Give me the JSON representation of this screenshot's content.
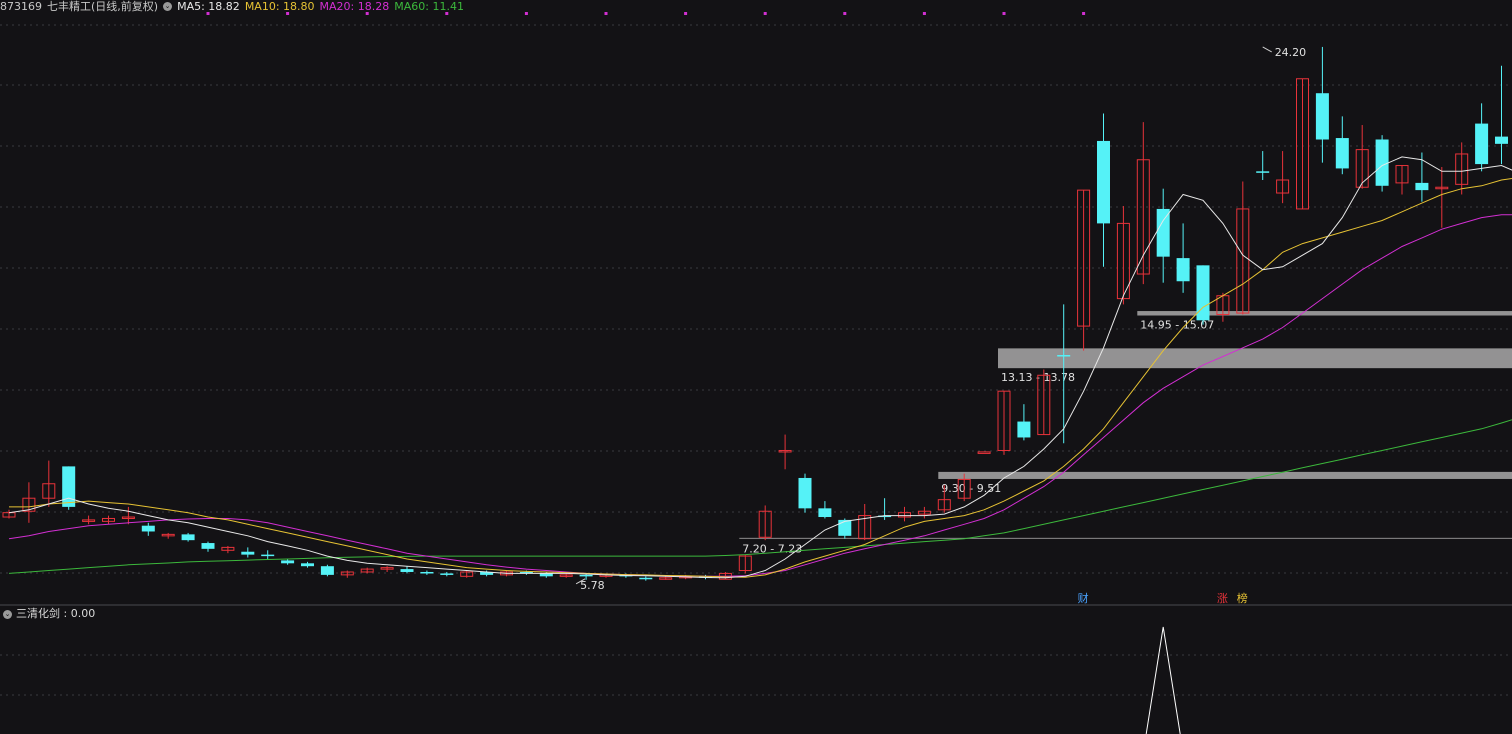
{
  "header": {
    "code": "873169",
    "name": "七丰精工",
    "period": "(日线,前复权)",
    "ma": [
      {
        "label": "MA5: 18.82",
        "color": "#e8e8e8"
      },
      {
        "label": "MA10: 18.80",
        "color": "#e6c234"
      },
      {
        "label": "MA20: 18.28",
        "color": "#d22fd2"
      },
      {
        "label": "MA60: 11.41",
        "color": "#3cb83c"
      }
    ]
  },
  "indicator": {
    "label": "三清化剑 : 0.00"
  },
  "colors": {
    "up": "#e8333a",
    "down": "#55f2f7",
    "ma5": "#e8e8e8",
    "ma10": "#e6c234",
    "ma20": "#d22fd2",
    "ma60": "#3cb83c",
    "zone": "#9a9a9a",
    "grid": "#3a3a3e",
    "event_fin": "#4aa3ff",
    "event_limit": "#e8333a",
    "event_list": "#e6c234"
  },
  "chart_data": {
    "type": "candlestick",
    "title": "",
    "price_axis": {
      "ymax": 25.2,
      "ymin": 5.6
    },
    "candles": [
      [
        7.95,
        8.1,
        8.2,
        7.9
      ],
      [
        8.15,
        8.6,
        9.15,
        7.75
      ],
      [
        8.6,
        9.1,
        9.9,
        8.3
      ],
      [
        9.7,
        8.3,
        9.7,
        8.2
      ],
      [
        7.85,
        7.85,
        8.0,
        7.7
      ],
      [
        7.8,
        7.9,
        8.0,
        7.7
      ],
      [
        7.95,
        7.95,
        8.3,
        7.7
      ],
      [
        7.65,
        7.45,
        7.75,
        7.3
      ],
      [
        7.35,
        7.35,
        7.4,
        7.2
      ],
      [
        7.35,
        7.15,
        7.4,
        7.1
      ],
      [
        7.05,
        6.85,
        7.1,
        6.75
      ],
      [
        6.8,
        6.9,
        6.95,
        6.7
      ],
      [
        6.75,
        6.65,
        6.9,
        6.55
      ],
      [
        6.65,
        6.6,
        6.8,
        6.5
      ],
      [
        6.45,
        6.35,
        6.5,
        6.3
      ],
      [
        6.35,
        6.25,
        6.4,
        6.2
      ],
      [
        6.25,
        5.95,
        6.3,
        5.9
      ],
      [
        5.95,
        6.05,
        6.1,
        5.85
      ],
      [
        6.05,
        6.15,
        6.2,
        6.0
      ],
      [
        6.15,
        6.2,
        6.25,
        6.05
      ],
      [
        6.15,
        6.05,
        6.25,
        6.0
      ],
      [
        6.05,
        6.0,
        6.1,
        5.95
      ],
      [
        6.0,
        5.95,
        6.05,
        5.9
      ],
      [
        5.9,
        6.05,
        6.1,
        5.85
      ],
      [
        6.05,
        5.95,
        6.1,
        5.9
      ],
      [
        5.95,
        6.05,
        6.1,
        5.9
      ],
      [
        6.05,
        6.0,
        6.1,
        5.95
      ],
      [
        6.0,
        5.9,
        6.05,
        5.85
      ],
      [
        5.9,
        5.95,
        6.0,
        5.85
      ],
      [
        5.95,
        5.9,
        6.0,
        5.78
      ],
      [
        5.9,
        5.95,
        6.0,
        5.85
      ],
      [
        5.95,
        5.9,
        6.0,
        5.85
      ],
      [
        5.85,
        5.8,
        5.9,
        5.75
      ],
      [
        5.85,
        5.85,
        5.9,
        5.78
      ],
      [
        5.85,
        5.9,
        5.95,
        5.8
      ],
      [
        5.9,
        5.85,
        5.95,
        5.8
      ],
      [
        5.8,
        6.0,
        6.05,
        5.8
      ],
      [
        6.1,
        6.6,
        6.65,
        6.0
      ],
      [
        7.25,
        8.15,
        8.35,
        7.15
      ],
      [
        10.25,
        10.25,
        10.8,
        9.6
      ],
      [
        9.3,
        8.25,
        9.45,
        8.1
      ],
      [
        8.25,
        7.95,
        8.5,
        7.9
      ],
      [
        7.85,
        7.3,
        7.9,
        7.2
      ],
      [
        7.2,
        8.0,
        8.4,
        7.15
      ],
      [
        8.0,
        7.95,
        8.6,
        7.85
      ],
      [
        7.95,
        8.1,
        8.3,
        7.8
      ],
      [
        8.05,
        8.15,
        8.3,
        7.9
      ],
      [
        8.2,
        8.55,
        9.05,
        8.1
      ],
      [
        8.6,
        9.25,
        9.45,
        8.5
      ],
      [
        10.2,
        10.2,
        10.2,
        10.2
      ],
      [
        10.25,
        12.3,
        12.3,
        10.1
      ],
      [
        11.25,
        10.7,
        11.85,
        10.6
      ],
      [
        10.8,
        12.85,
        13.05,
        10.8
      ],
      [
        13.55,
        13.5,
        15.3,
        10.5
      ],
      [
        14.55,
        19.25,
        19.25,
        13.7
      ],
      [
        20.95,
        18.1,
        21.9,
        16.6
      ],
      [
        15.5,
        18.1,
        18.7,
        15.3
      ],
      [
        16.35,
        20.3,
        21.6,
        16.0
      ],
      [
        18.6,
        16.95,
        19.3,
        16.05
      ],
      [
        16.9,
        16.1,
        18.1,
        15.7
      ],
      [
        16.65,
        14.75,
        16.65,
        14.6
      ],
      [
        14.95,
        15.6,
        15.7,
        14.7
      ],
      [
        15.0,
        18.6,
        19.55,
        14.95
      ],
      [
        19.9,
        19.85,
        20.6,
        19.6
      ],
      [
        19.15,
        19.6,
        20.6,
        18.8
      ],
      [
        18.6,
        23.1,
        23.1,
        18.6
      ],
      [
        22.6,
        21.0,
        24.2,
        20.2
      ],
      [
        21.05,
        20.0,
        21.8,
        19.8
      ],
      [
        19.35,
        20.65,
        21.5,
        19.3
      ],
      [
        21.0,
        19.4,
        21.15,
        19.2
      ],
      [
        19.5,
        20.1,
        20.1,
        19.1
      ],
      [
        19.5,
        19.25,
        20.55,
        18.85
      ],
      [
        19.3,
        19.35,
        20.05,
        17.95
      ],
      [
        19.45,
        20.5,
        20.9,
        19.1
      ],
      [
        21.55,
        20.15,
        22.25,
        19.9
      ],
      [
        21.1,
        20.85,
        23.55,
        20.15
      ],
      [
        20.05,
        18.7,
        20.45,
        18.05
      ]
    ],
    "ma5": [
      8.1,
      8.2,
      8.4,
      8.6,
      8.4,
      8.25,
      8.15,
      8.0,
      7.85,
      7.75,
      7.6,
      7.45,
      7.3,
      7.1,
      6.95,
      6.8,
      6.6,
      6.45,
      6.35,
      6.3,
      6.25,
      6.2,
      6.15,
      6.1,
      6.05,
      6.0,
      6.0,
      6.0,
      6.0,
      5.98,
      5.95,
      5.93,
      5.92,
      5.9,
      5.88,
      5.86,
      5.85,
      5.9,
      6.1,
      6.5,
      7.0,
      7.5,
      7.8,
      7.9,
      8.0,
      8.0,
      8.0,
      8.05,
      8.3,
      8.7,
      9.3,
      9.7,
      10.3,
      11.0,
      12.3,
      13.8,
      15.6,
      17.0,
      18.2,
      19.1,
      18.9,
      18.1,
      17.0,
      16.5,
      16.6,
      17.0,
      17.4,
      18.3,
      19.5,
      20.1,
      20.4,
      20.3,
      19.9,
      19.9,
      20.0,
      20.1,
      19.8
    ],
    "ma10": [
      8.3,
      8.3,
      8.4,
      8.45,
      8.5,
      8.45,
      8.4,
      8.3,
      8.2,
      8.1,
      7.95,
      7.85,
      7.7,
      7.55,
      7.4,
      7.25,
      7.1,
      6.95,
      6.8,
      6.65,
      6.5,
      6.4,
      6.3,
      6.2,
      6.15,
      6.1,
      6.07,
      6.05,
      6.03,
      6.0,
      5.98,
      5.96,
      5.95,
      5.93,
      5.92,
      5.9,
      5.88,
      5.87,
      5.95,
      6.15,
      6.4,
      6.6,
      6.8,
      7.0,
      7.3,
      7.6,
      7.8,
      7.9,
      8.0,
      8.2,
      8.5,
      8.85,
      9.2,
      9.7,
      10.3,
      11.0,
      11.9,
      12.8,
      13.7,
      14.5,
      15.2,
      15.6,
      16.0,
      16.5,
      17.1,
      17.4,
      17.6,
      17.8,
      18.0,
      18.2,
      18.5,
      18.8,
      19.1,
      19.3,
      19.4,
      19.6,
      19.7
    ],
    "ma20": [
      7.2,
      7.3,
      7.45,
      7.55,
      7.65,
      7.7,
      7.75,
      7.8,
      7.85,
      7.88,
      7.9,
      7.9,
      7.85,
      7.75,
      7.6,
      7.45,
      7.3,
      7.15,
      7.0,
      6.85,
      6.7,
      6.6,
      6.5,
      6.4,
      6.3,
      6.22,
      6.15,
      6.1,
      6.05,
      6.0,
      5.98,
      5.96,
      5.94,
      5.92,
      5.91,
      5.9,
      5.9,
      5.92,
      6.0,
      6.1,
      6.3,
      6.5,
      6.7,
      6.85,
      7.0,
      7.15,
      7.3,
      7.5,
      7.7,
      7.9,
      8.2,
      8.6,
      9.0,
      9.5,
      10.1,
      10.7,
      11.3,
      11.9,
      12.4,
      12.8,
      13.2,
      13.5,
      13.8,
      14.1,
      14.5,
      15.0,
      15.5,
      16.0,
      16.5,
      16.9,
      17.3,
      17.6,
      17.9,
      18.1,
      18.3,
      18.4,
      18.4
    ],
    "ma60": [
      6.0,
      6.05,
      6.1,
      6.15,
      6.2,
      6.25,
      6.3,
      6.33,
      6.36,
      6.4,
      6.42,
      6.44,
      6.46,
      6.48,
      6.5,
      6.52,
      6.54,
      6.56,
      6.57,
      6.58,
      6.59,
      6.6,
      6.6,
      6.6,
      6.6,
      6.6,
      6.6,
      6.6,
      6.6,
      6.6,
      6.6,
      6.6,
      6.6,
      6.6,
      6.6,
      6.6,
      6.62,
      6.65,
      6.7,
      6.75,
      6.8,
      6.85,
      6.9,
      6.95,
      7.0,
      7.05,
      7.1,
      7.15,
      7.2,
      7.3,
      7.4,
      7.55,
      7.7,
      7.85,
      8.0,
      8.15,
      8.3,
      8.45,
      8.6,
      8.75,
      8.9,
      9.05,
      9.2,
      9.35,
      9.5,
      9.65,
      9.8,
      9.95,
      10.1,
      10.25,
      10.4,
      10.55,
      10.7,
      10.85,
      11.0,
      11.2,
      11.41
    ],
    "zones": [
      {
        "label": "14.95 - 15.07",
        "start": 57,
        "low": 14.95,
        "high": 15.07
      },
      {
        "label": "13.13 - 13.78",
        "start": 50,
        "low": 13.13,
        "high": 13.78
      },
      {
        "label": "9.30 - 9.51",
        "start": 47,
        "low": 9.3,
        "high": 9.51
      },
      {
        "label": "7.20 - 7.23",
        "start": 37,
        "low": 7.2,
        "high": 7.23
      }
    ],
    "annotations": [
      {
        "text": "24.20",
        "index": 63,
        "price": 24.2,
        "side": "high"
      },
      {
        "text": "5.78",
        "index": 29,
        "price": 5.78,
        "side": "low"
      }
    ],
    "event_markers": [
      {
        "text": "财",
        "index": 54,
        "kind": "fin"
      },
      {
        "text": "涨",
        "index": 61,
        "kind": "limit"
      },
      {
        "text": "榜",
        "index": 62,
        "kind": "list"
      }
    ],
    "top_marks": [
      10,
      14,
      18,
      22,
      26,
      30,
      34,
      38,
      42,
      46,
      50,
      54
    ],
    "indicator_series": {
      "name": "三清化剑",
      "spike_index": 58,
      "values_nonzero": 1
    }
  }
}
